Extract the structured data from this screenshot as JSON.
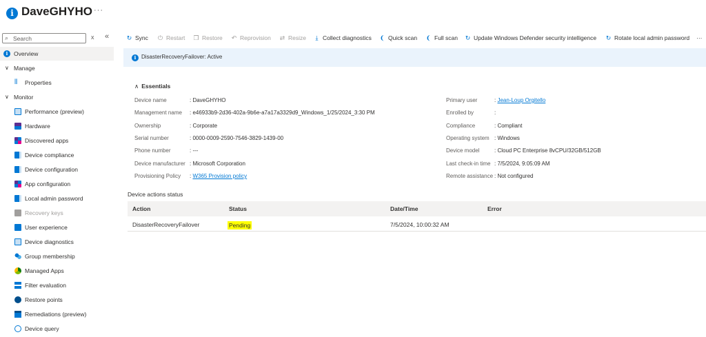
{
  "header": {
    "title": "DaveGHYHO",
    "more": "···",
    "icon": "info-icon"
  },
  "sidebar": {
    "search_placeholder": "Search",
    "clear": "x",
    "collapse": "«",
    "items": [
      {
        "label": "Overview",
        "type": "active",
        "icon": "info-icon"
      },
      {
        "label": "Manage",
        "type": "group",
        "icon": "chevron-down-icon"
      },
      {
        "label": "Properties",
        "type": "item",
        "icon": "properties-icon"
      },
      {
        "label": "Monitor",
        "type": "group",
        "icon": "chevron-down-icon"
      },
      {
        "label": "Performance (preview)",
        "type": "item",
        "icon": "performance-icon"
      },
      {
        "label": "Hardware",
        "type": "item",
        "icon": "hardware-icon"
      },
      {
        "label": "Discovered apps",
        "type": "item",
        "icon": "apps-icon"
      },
      {
        "label": "Device compliance",
        "type": "item",
        "icon": "compliance-icon"
      },
      {
        "label": "Device configuration",
        "type": "item",
        "icon": "configuration-icon"
      },
      {
        "label": "App configuration",
        "type": "item",
        "icon": "app-configuration-icon"
      },
      {
        "label": "Local admin password",
        "type": "item",
        "icon": "password-icon"
      },
      {
        "label": "Recovery keys",
        "type": "disabled",
        "icon": "key-icon"
      },
      {
        "label": "User experience",
        "type": "item",
        "icon": "user-experience-icon"
      },
      {
        "label": "Device diagnostics",
        "type": "item",
        "icon": "diagnostics-icon"
      },
      {
        "label": "Group membership",
        "type": "item",
        "icon": "group-icon"
      },
      {
        "label": "Managed Apps",
        "type": "item",
        "icon": "managed-apps-icon"
      },
      {
        "label": "Filter evaluation",
        "type": "item",
        "icon": "filter-icon"
      },
      {
        "label": "Restore points",
        "type": "item",
        "icon": "restore-icon"
      },
      {
        "label": "Remediations (preview)",
        "type": "item",
        "icon": "remediations-icon"
      },
      {
        "label": "Device query",
        "type": "item",
        "icon": "query-icon"
      }
    ]
  },
  "toolbar": {
    "sync": "Sync",
    "restart": "Restart",
    "restore": "Restore",
    "reprovision": "Reprovision",
    "resize": "Resize",
    "collect": "Collect diagnostics",
    "quick_scan": "Quick scan",
    "full_scan": "Full scan",
    "update_defender": "Update Windows Defender security intelligence",
    "rotate": "Rotate local admin password",
    "more": "···"
  },
  "banner": {
    "text": "DisasterRecoveryFailover: Active"
  },
  "essentials": {
    "title": "Essentials",
    "left": [
      {
        "key": "Device name",
        "value": "DaveGHYHO"
      },
      {
        "key": "Management name",
        "value": "e46933b9-2d36-402a-9b6e-a7a17a3329d9_Windows_1/25/2024_3:30 PM"
      },
      {
        "key": "Ownership",
        "value": "Corporate"
      },
      {
        "key": "Serial number",
        "value": "0000-0009-2590-7546-3829-1439-00"
      },
      {
        "key": "Phone number",
        "value": "---"
      },
      {
        "key": "Device manufacturer",
        "value": "Microsoft Corporation"
      },
      {
        "key": "Provisioning Policy",
        "value": "W365 Provision policy"
      }
    ],
    "right": [
      {
        "key": "Primary user",
        "value": "Jean-Loup Orgitello"
      },
      {
        "key": "Enrolled by",
        "value": ""
      },
      {
        "key": "Compliance",
        "value": "Compliant"
      },
      {
        "key": "Operating system",
        "value": "Windows"
      },
      {
        "key": "Device model",
        "value": "Cloud PC Enterprise 8vCPU/32GB/512GB"
      },
      {
        "key": "Last check-in time",
        "value": "7/5/2024, 9:05:09 AM"
      },
      {
        "key": "Remote assistance",
        "value": "Not configured"
      }
    ]
  },
  "actions_status": {
    "title": "Device actions status",
    "columns": [
      "Action",
      "Status",
      "Date/Time",
      "Error"
    ],
    "rows": [
      {
        "action": "DisasterRecoveryFailover",
        "status": "Pending",
        "datetime": "7/5/2024, 10:00:32 AM",
        "error": ""
      }
    ]
  },
  "colors": {
    "accent": "#0078d4",
    "highlight": "#ffff00",
    "banner_bg": "#eaf3fc"
  }
}
